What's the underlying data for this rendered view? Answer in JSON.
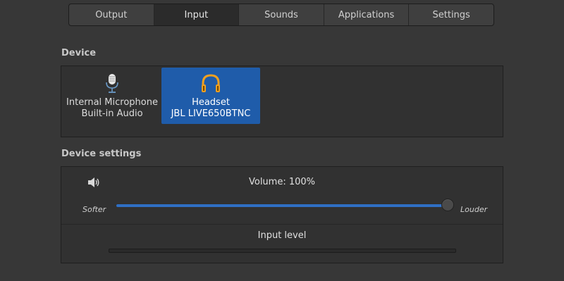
{
  "tabs": [
    {
      "label": "Output",
      "active": false
    },
    {
      "label": "Input",
      "active": true
    },
    {
      "label": "Sounds",
      "active": false
    },
    {
      "label": "Applications",
      "active": false
    },
    {
      "label": "Settings",
      "active": false
    }
  ],
  "device_section": {
    "title": "Device",
    "devices": [
      {
        "name": "Internal Microphone",
        "subtitle": "Built-in Audio",
        "icon": "microphone-icon",
        "selected": false
      },
      {
        "name": "Headset",
        "subtitle": "JBL LIVE650BTNC",
        "icon": "headphones-icon",
        "selected": true
      }
    ]
  },
  "settings_section": {
    "title": "Device settings",
    "volume_label": "Volume: 100%",
    "volume_percent": 100,
    "softer_label": "Softer",
    "louder_label": "Louder",
    "input_level_label": "Input level",
    "input_level_percent": 0
  },
  "colors": {
    "accent": "#1f5caa",
    "slider_fill": "#2f6fc4",
    "background": "#373737"
  }
}
